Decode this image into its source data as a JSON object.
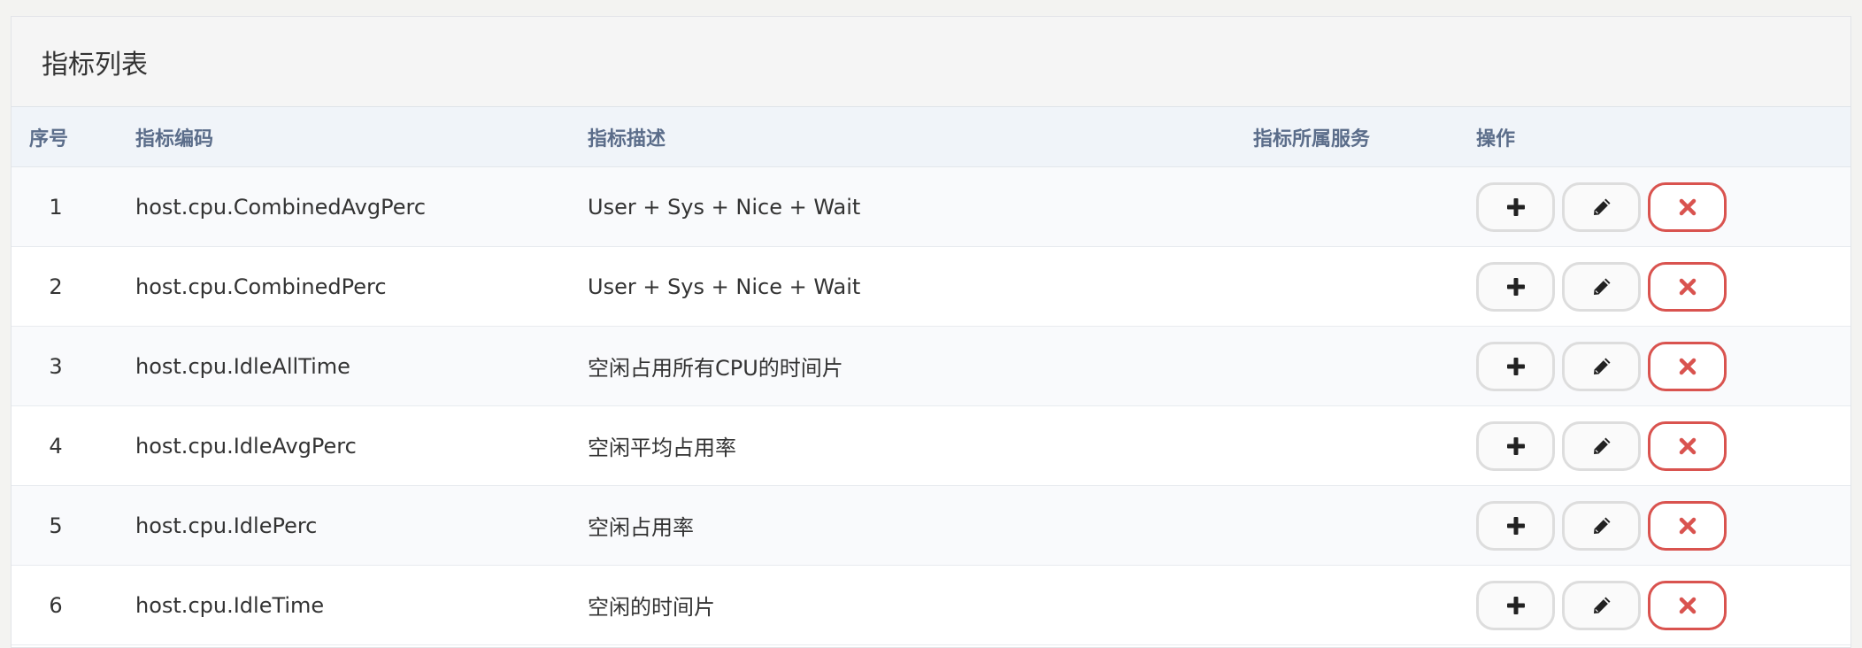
{
  "panel": {
    "title": "指标列表"
  },
  "table": {
    "headers": {
      "no": "序号",
      "code": "指标编码",
      "desc": "指标描述",
      "service": "指标所属服务",
      "ops": "操作"
    },
    "rows": [
      {
        "no": "1",
        "code": "host.cpu.CombinedAvgPerc",
        "desc": "User + Sys + Nice + Wait",
        "service": ""
      },
      {
        "no": "2",
        "code": "host.cpu.CombinedPerc",
        "desc": "User + Sys + Nice + Wait",
        "service": ""
      },
      {
        "no": "3",
        "code": "host.cpu.IdleAllTime",
        "desc": "空闲占用所有CPU的时间片",
        "service": ""
      },
      {
        "no": "4",
        "code": "host.cpu.IdleAvgPerc",
        "desc": "空闲平均占用率",
        "service": ""
      },
      {
        "no": "5",
        "code": "host.cpu.IdlePerc",
        "desc": "空闲占用率",
        "service": ""
      },
      {
        "no": "6",
        "code": "host.cpu.IdleTime",
        "desc": "空闲的时间片",
        "service": ""
      }
    ]
  },
  "icons": {
    "add": "plus-icon",
    "edit": "pencil-icon",
    "delete": "close-icon"
  },
  "colors": {
    "delete_accent": "#d9534f",
    "header_text": "#5b6d8a"
  }
}
